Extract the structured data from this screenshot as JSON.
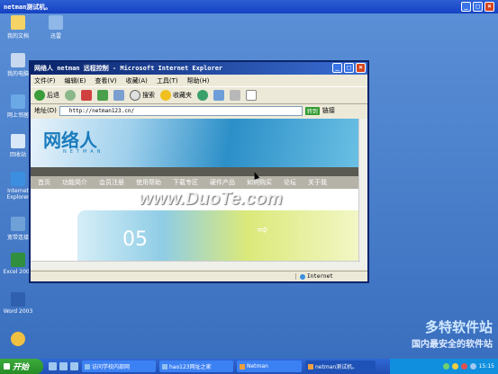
{
  "outer_window": {
    "title": "netman测试机。",
    "min_label": "_",
    "max_label": "□",
    "close_label": "×"
  },
  "remote_toolbar": {
    "icons": [
      "⊘",
      "⟲",
      "⚙",
      "⊙",
      "▣",
      "✎",
      "▤",
      "⇄",
      "⌧",
      "▬",
      "⊞"
    ]
  },
  "desktop_icons": [
    {
      "name": "desktop-icon-my-documents",
      "label": "我的文档",
      "color": "#f6d365"
    },
    {
      "name": "desktop-icon-tools",
      "label": "迅雷",
      "color": "#8fb8e8"
    },
    {
      "name": "desktop-icon-my-computer",
      "label": "我的电脑",
      "color": "#c8d8ee"
    },
    {
      "name": "desktop-icon-network",
      "label": "网上邻居",
      "color": "#6aa8e6"
    },
    {
      "name": "desktop-icon-recycle",
      "label": "回收站",
      "color": "#d8e8f8"
    },
    {
      "name": "desktop-icon-ie",
      "label": "Internet Explorer",
      "color": "#3c8fe0"
    },
    {
      "name": "desktop-icon-broadband",
      "label": "宽带连接",
      "color": "#6fa0d8"
    },
    {
      "name": "desktop-icon-excel",
      "label": "Excel 2003",
      "color": "#2f8f3f"
    },
    {
      "name": "desktop-icon-word",
      "label": "Word 2003",
      "color": "#2f5faf"
    },
    {
      "name": "desktop-icon-qq",
      "label": "",
      "color": "#f0c040"
    }
  ],
  "ie": {
    "title": "网络人 netman 远程控制 - Microsoft Internet Explorer",
    "menu": [
      "文件(F)",
      "编辑(E)",
      "查看(V)",
      "收藏(A)",
      "工具(T)",
      "帮助(H)"
    ],
    "toolbar": {
      "back": "后退",
      "search": "搜索",
      "favorites": "收藏夹"
    },
    "address_label": "地址(D)",
    "address_value": "http://netman123.cn/",
    "go_label": "转到",
    "links_label": "链接",
    "status_zone": "Internet"
  },
  "site": {
    "logo": "网络人",
    "logo_sub": "NETMAN",
    "nav": [
      "首页",
      "功能简介",
      "会员注册",
      "使用帮助",
      "下载专区",
      "硬件产品",
      "如何购买",
      "论坛",
      "关于我"
    ],
    "watermark": "www.DuoTe.com",
    "content_num": "05",
    "content_arrow": "⇨"
  },
  "taskbar": {
    "start_label": "开始",
    "tasks": [
      {
        "name": "task-button-ie",
        "label": "访问学校内部网"
      },
      {
        "name": "task-button-hao123",
        "label": "hao123网址之家"
      },
      {
        "name": "task-button-netman",
        "label": "Netman"
      },
      {
        "name": "task-button-remote",
        "label": "netman测试机。"
      }
    ],
    "clock": "15:15"
  },
  "brand_watermark": {
    "line1": "多特软件站",
    "line2": "国内最安全的软件站"
  },
  "colors": {
    "titlebar": "#1541c2",
    "taskbar": "#3168d5",
    "start": "#268c26",
    "desktop": "#3a6fbf"
  }
}
